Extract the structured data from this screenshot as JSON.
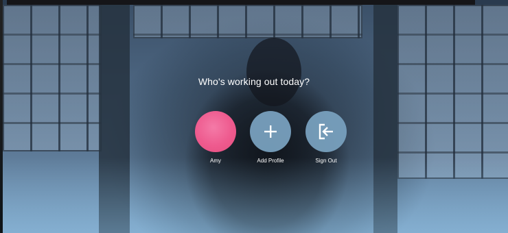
{
  "screen": {
    "prompt": "Who's working out today?"
  },
  "profiles": [
    {
      "label": "Amy",
      "icon": "avatar",
      "color": "#ee5a8e"
    },
    {
      "label": "Add Profile",
      "icon": "plus-icon",
      "color": "#78a0be"
    },
    {
      "label": "Sign Out",
      "icon": "sign-out-icon",
      "color": "#78a0be"
    }
  ]
}
